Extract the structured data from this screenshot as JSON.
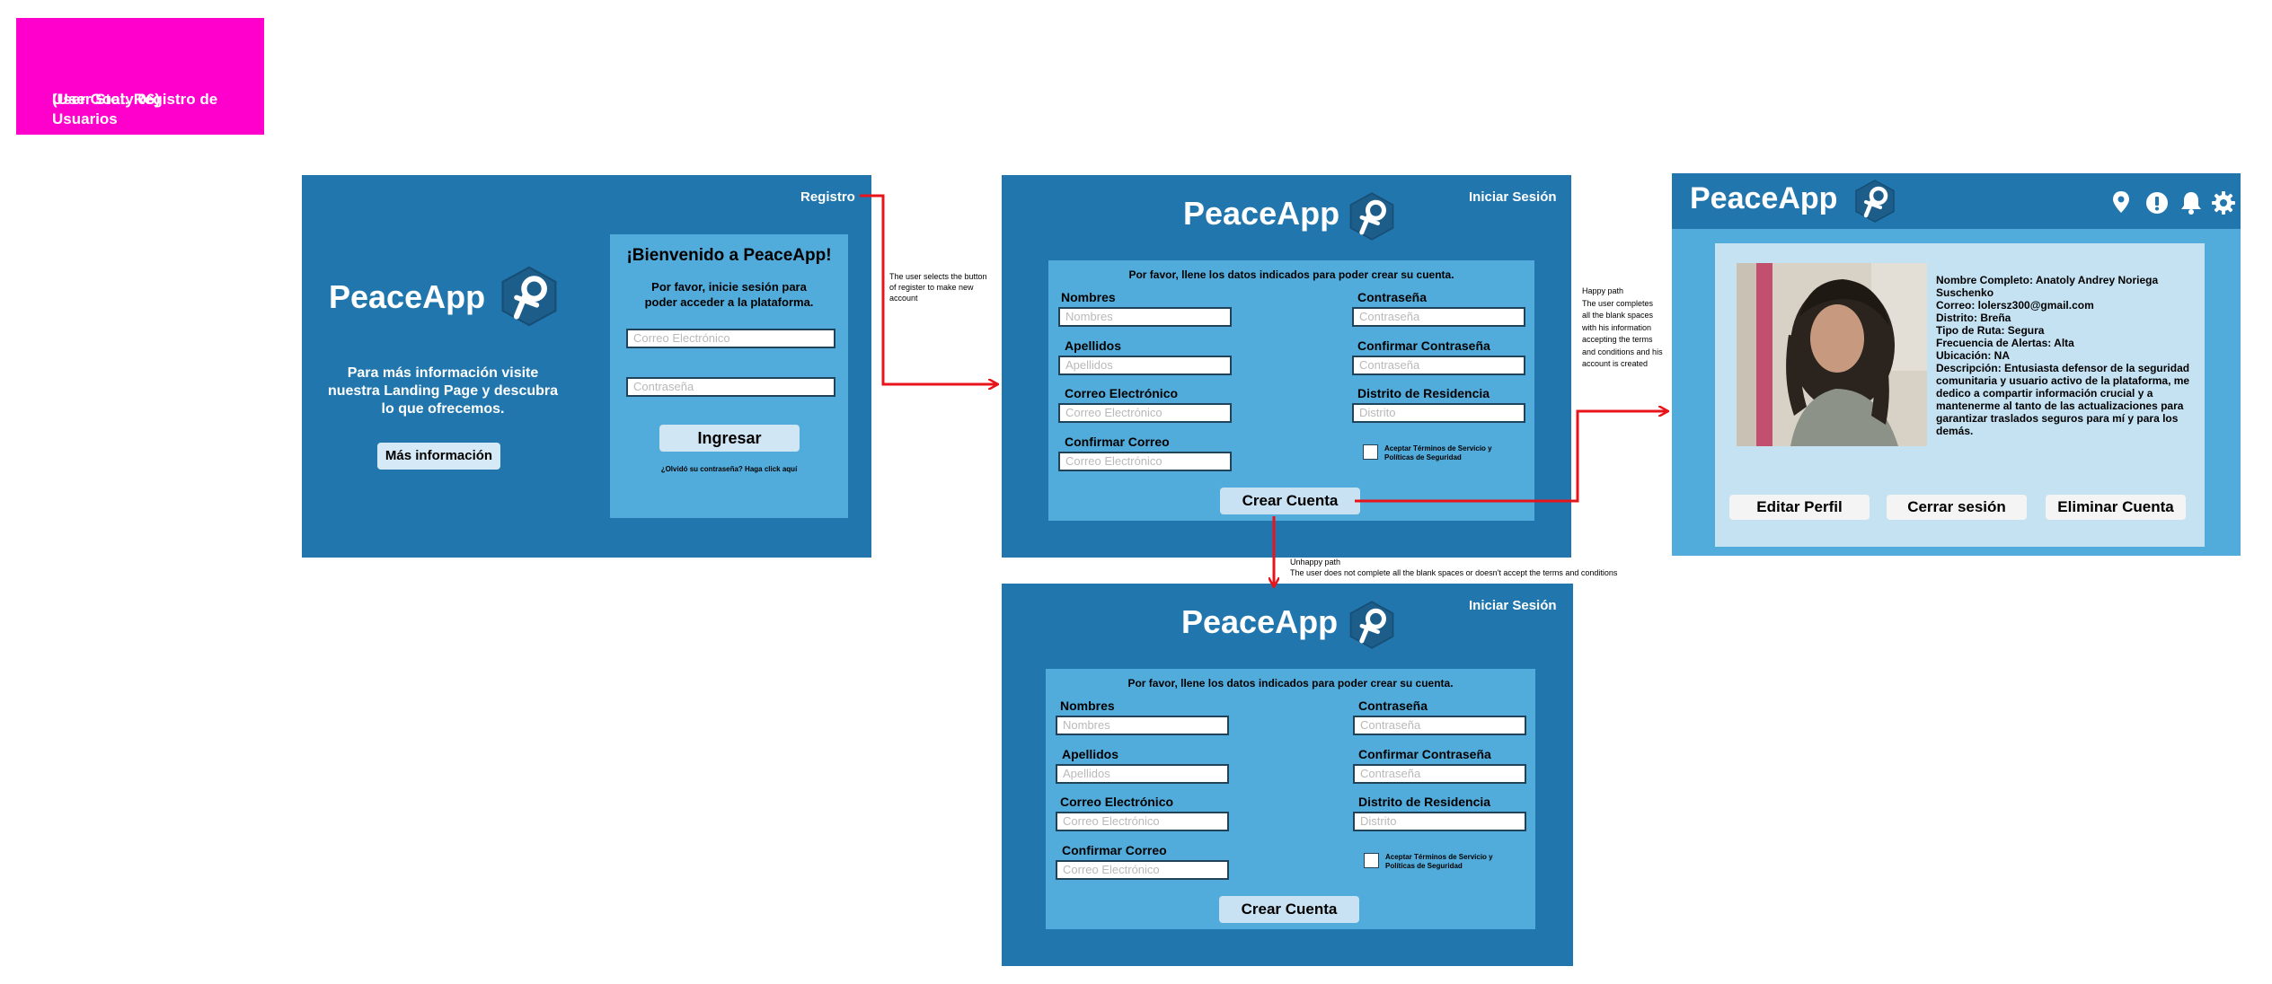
{
  "goal": {
    "line1": "User Goal: Registro de Usuarios",
    "line2": "(User Stoty 06)"
  },
  "brand": "PeaceApp",
  "login": {
    "register_link": "Registro",
    "info_line1": "Para más información visite",
    "info_line2": "nuestra Landing Page y descubra",
    "info_line3": "lo que ofrecemos.",
    "more_info_button": "Más información",
    "welcome_title": "¡Bienvenido a PeaceApp!",
    "welcome_sub1": "Por favor, inicie sesión para",
    "welcome_sub2": "poder acceder a la plataforma.",
    "email_placeholder": "Correo Electrónico",
    "password_placeholder": "Contraseña",
    "login_button": "Ingresar",
    "forgot": "¿Olvidó su contraseña? Haga click aquí"
  },
  "notes": {
    "to_register": [
      "The user selects the button",
      "of register to make  new",
      "account"
    ],
    "happy": [
      "Happy path",
      "The user completes",
      "all the blank spaces",
      "with his information",
      "accepting the terms",
      "and conditions and his",
      "account is created"
    ],
    "unhappy_title": "Unhappy path",
    "unhappy_text": "The user does not complete all the blank spaces or doesn't accept the terms and conditions"
  },
  "register": {
    "signin_link": "Iniciar Sesión",
    "instructions": "Por favor, llene los datos indicados para poder crear su cuenta.",
    "fields": {
      "nombres_label": "Nombres",
      "nombres_ph": "Nombres",
      "apellidos_label": "Apellidos",
      "apellidos_ph": "Apellidos",
      "correo_label": "Correo Electrónico",
      "correo_ph": "Correo Electrónico",
      "confirm_correo_label": "Confirmar Correo",
      "confirm_correo_ph": "Correo Electrónico",
      "password_label": "Contraseña",
      "password_ph": "Contraseña",
      "confirm_password_label": "Confirmar Contraseña",
      "confirm_password_ph": "Contraseña",
      "distrito_label": "Distrito de Residencia",
      "distrito_ph": "Distrito"
    },
    "terms_line1": "Aceptar Términos de Servicio y",
    "terms_line2": "Políticas de Seguridad",
    "create_button": "Crear Cuenta"
  },
  "profile": {
    "lines": [
      "Nombre Completo: Anatoly Andrey Noriega",
      "Suschenko",
      "Correo: lolersz300@gmail.com",
      "Distrito: Breña",
      "Tipo de Ruta: Segura",
      "Frecuencia de Alertas: Alta",
      "Ubicación: NA",
      "Descripción: Entusiasta defensor de la seguridad",
      "comunitaria y usuario activo de la plataforma, me",
      "dedico a compartir información crucial y a",
      "mantenerme al tanto de las actualizaciones para",
      "garantizar traslados seguros para mí y para los",
      "demás."
    ],
    "edit_button": "Editar Perfil",
    "logout_button": "Cerrar sesión",
    "delete_button": "Eliminar Cuenta",
    "icons": [
      "location-icon",
      "alert-icon",
      "bell-icon",
      "gear-icon"
    ]
  },
  "colors": {
    "screen": "#2177ad",
    "panel": "#52acdb",
    "light": "#c5e2f3",
    "goal": "#ff00cc",
    "arrow": "#e8141b"
  }
}
